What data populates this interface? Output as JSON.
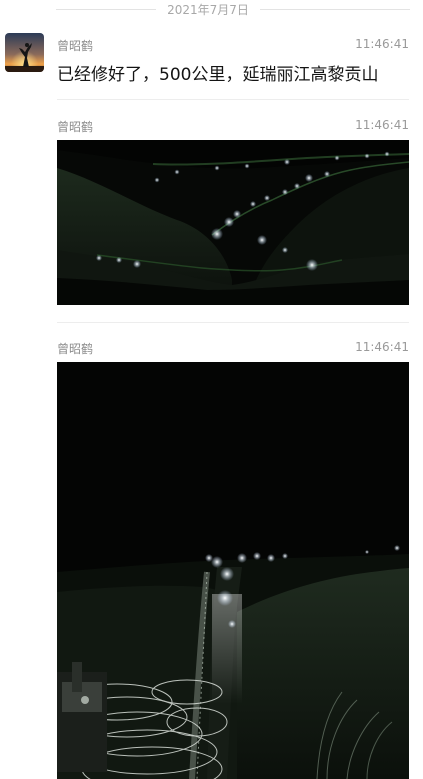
{
  "date_divider": "2021年7月7日",
  "messages": [
    {
      "sender": "曾昭鹤",
      "time": "11:46:41",
      "text": "已经修好了，500公里，延瑞丽江高黎贡山"
    },
    {
      "sender": "曾昭鹤",
      "time": "11:46:41"
    },
    {
      "sender": "曾昭鹤",
      "time": "11:46:41"
    }
  ],
  "colors": {
    "divider_text": "#a8a8a8",
    "sender_text": "#8c8c8c",
    "message_text": "#141414",
    "photo_background": "#050605"
  }
}
